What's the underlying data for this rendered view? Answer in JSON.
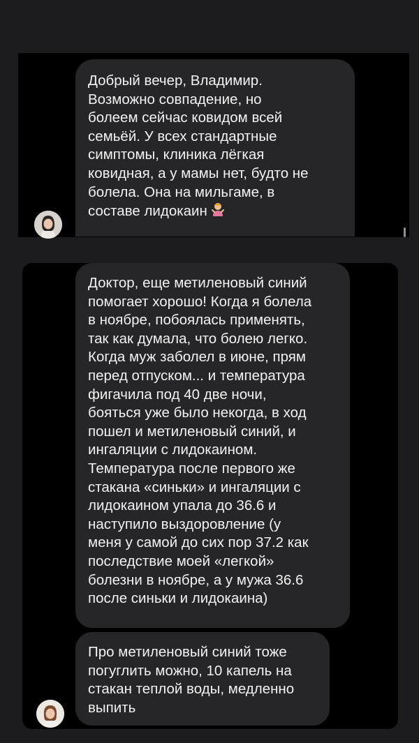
{
  "messages": [
    {
      "lines": [
        "Добрый вечер, Владимир.",
        "Возможно совпадение,  но",
        "болеем  сейчас ковидом всей",
        "семьёй.  У всех стандартные",
        "симптомы, клиника лёгкая",
        "ковидная, а у мамы нет, будто не",
        "болела. Она на  мильгаме, в",
        "составе лидокаин"
      ],
      "emoji_icon": "person-shrugging-icon"
    },
    {
      "lines": [
        "Доктор, еще метиленовый синий",
        "помогает хорошо! Когда я болела",
        "в ноябре, побоялась применять,",
        "так как думала, что болею легко.",
        "Когда муж заболел в июне, прям",
        "перед отпуском... и температура",
        "фигачила под 40 две ночи,",
        "бояться уже было некогда, в ход",
        "пошел и метиленовый синий, и",
        "ингаляции с лидокаином.",
        "Температура после первого же",
        "стакана «синьки» и ингаляции с",
        "лидокаином упала до 36.6 и",
        "наступило выздоровление (у",
        "меня у самой до сих пор 37.2 как",
        "последствие моей «легкой»",
        "болезни в ноябре, а у мужа 36.6",
        "после синьки и лидокаина)"
      ]
    },
    {
      "lines": [
        "Про метиленовый синий тоже",
        "погуглить можно, 10 капель на",
        "стакан теплой воды, медленно",
        "выпить"
      ]
    }
  ],
  "colors": {
    "background": "#1c1c1e",
    "panel": "#000000",
    "bubble": "#262628",
    "text": "#f2f2f2"
  }
}
